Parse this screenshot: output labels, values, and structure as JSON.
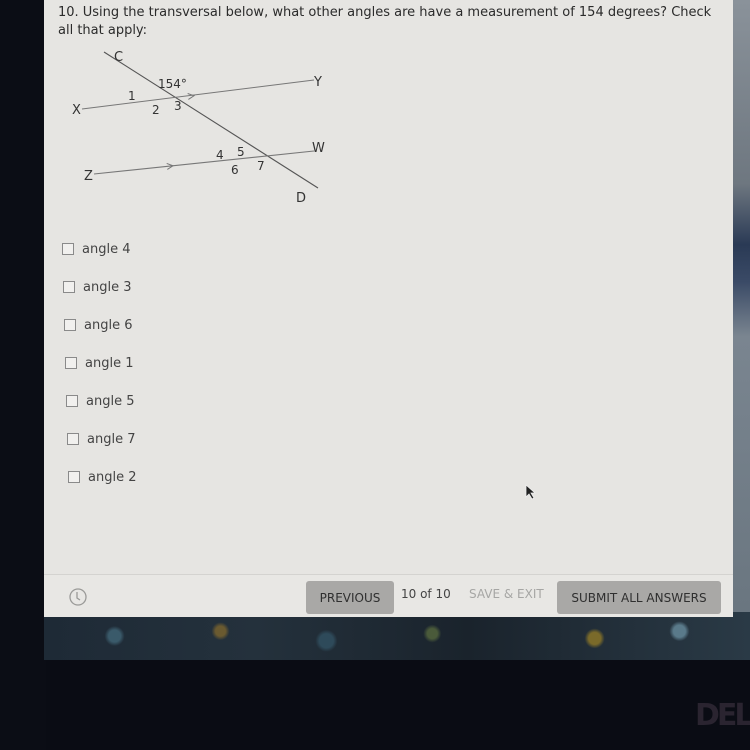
{
  "question": {
    "number": "10.",
    "text": "Using the transversal below, what other angles are have a measurement of 154 degrees?  Check all that apply:"
  },
  "diagram": {
    "point_labels": {
      "C": "C",
      "D": "D",
      "X": "X",
      "Y": "Y",
      "Z": "Z",
      "W": "W"
    },
    "given_angle": "154°",
    "angle_labels": {
      "a1": "1",
      "a2": "2",
      "a3": "3",
      "a4": "4",
      "a5": "5",
      "a6": "6",
      "a7": "7"
    }
  },
  "options": [
    {
      "label": "angle 4",
      "checked": false
    },
    {
      "label": "angle 3",
      "checked": false
    },
    {
      "label": "angle 6",
      "checked": false
    },
    {
      "label": "angle 1",
      "checked": false
    },
    {
      "label": "angle 5",
      "checked": false
    },
    {
      "label": "angle 7",
      "checked": false
    },
    {
      "label": "angle 2",
      "checked": false
    }
  ],
  "footer": {
    "previous_label": "PREVIOUS",
    "page_count": "10 of 10",
    "save_exit_label": "SAVE & EXIT",
    "submit_label": "SUBMIT ALL ANSWERS"
  },
  "brand_logo": "DELL"
}
